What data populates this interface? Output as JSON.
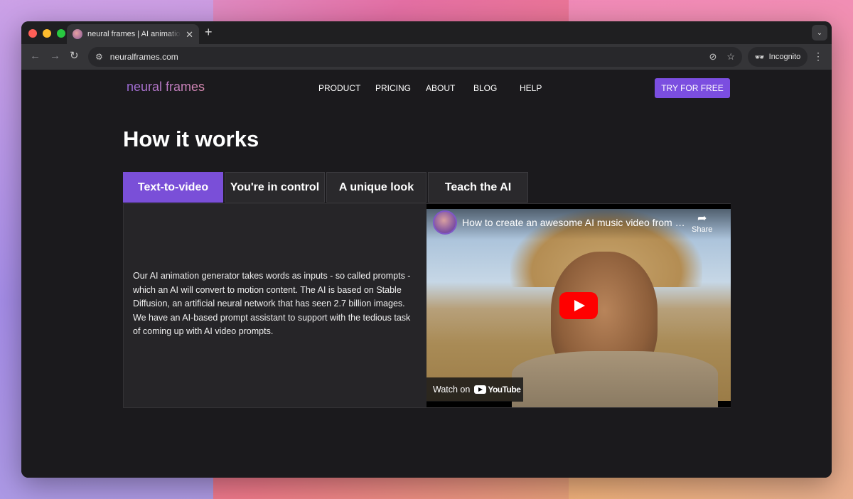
{
  "browser": {
    "tab_title": "neural frames | AI animation generator",
    "new_tab": "+",
    "url": "neuralframes.com",
    "incognito_label": "Incognito"
  },
  "site": {
    "logo": "neural frames",
    "nav": [
      "PRODUCT",
      "PRICING",
      "ABOUT",
      "BLOG",
      "HELP"
    ],
    "cta": "TRY FOR FREE"
  },
  "section": {
    "heading": "How it works",
    "tabs": [
      "Text-to-video",
      "You're in control",
      "A unique look",
      "Teach the AI"
    ],
    "active_tab": "Text-to-video",
    "description": "Our AI animation generator takes words as inputs - so called prompts - which an AI will convert to motion content. The AI is based on Stable Diffusion, an artificial neural network that has seen 2.7 billion images. We have an AI-based prompt assistant to support with the tedious task of coming up with AI video prompts."
  },
  "video": {
    "title": "How to create an awesome AI music video from scratch",
    "share_label": "Share",
    "watch_on": "Watch on",
    "youtube": "YouTube"
  },
  "colors": {
    "accent": "#7b4ee0",
    "page_bg": "#1b1a1d",
    "panel_bg": "#262528",
    "youtube_red": "#ff0000"
  }
}
